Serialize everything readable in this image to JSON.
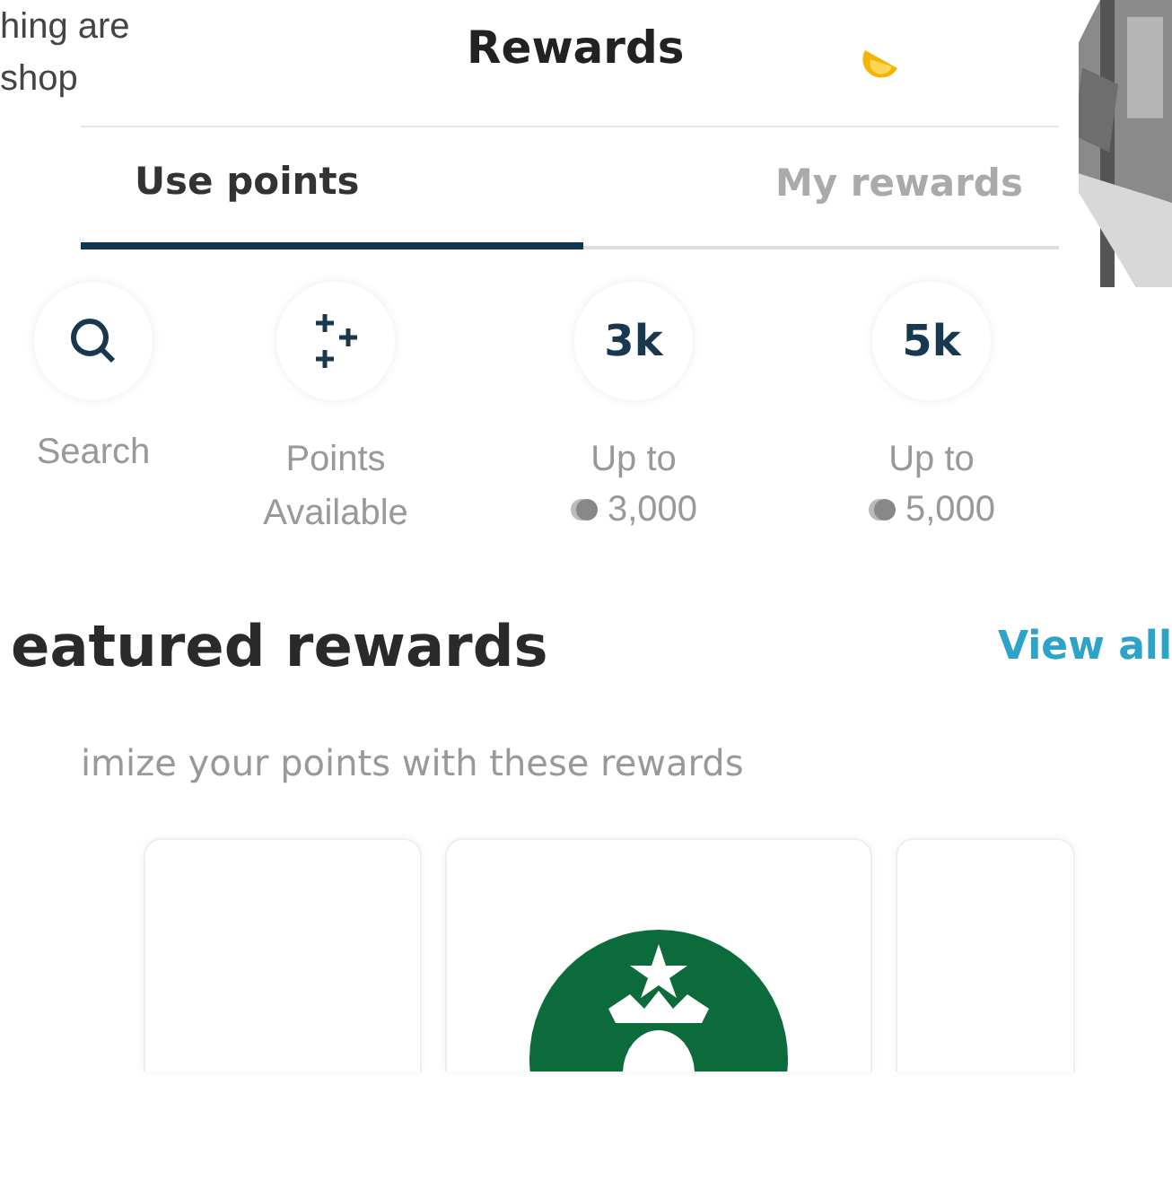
{
  "background_text": [
    "hing are",
    "shop"
  ],
  "header": {
    "title": "Rewards"
  },
  "tabs": [
    {
      "label": "Use points",
      "selected": true
    },
    {
      "label": "My rewards",
      "selected": false
    }
  ],
  "quick_actions": [
    {
      "kind": "search",
      "label": "Search"
    },
    {
      "kind": "sparkle",
      "label": "Points Available"
    },
    {
      "kind": "tier",
      "badge": "3k",
      "label": "Up to",
      "points": "3,000"
    },
    {
      "kind": "tier",
      "badge": "5k",
      "label": "Up to",
      "points": "5,000"
    }
  ],
  "featured": {
    "title": "eatured rewards",
    "link": "View all",
    "subtitle": "imize your points with these rewards"
  },
  "cards": [
    {
      "kind": "blank"
    },
    {
      "kind": "logo"
    },
    {
      "kind": "blank"
    }
  ]
}
